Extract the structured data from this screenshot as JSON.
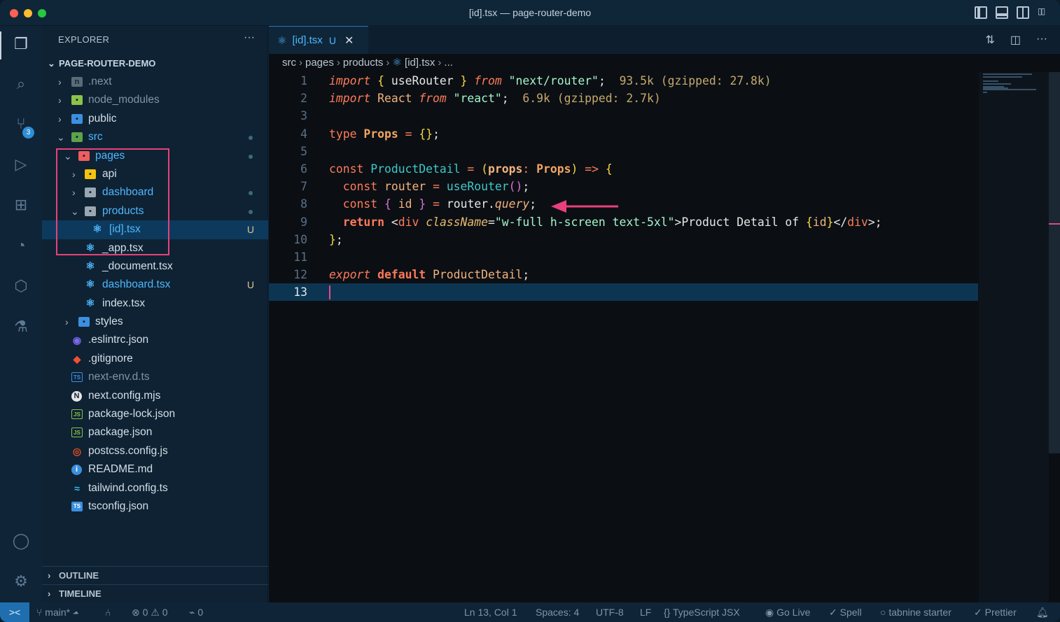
{
  "window": {
    "title": "[id].tsx — page-router-demo"
  },
  "activity": {
    "scm_badge": "3",
    "icons": [
      "explorer-icon",
      "search-icon",
      "source-control-icon",
      "run-debug-icon",
      "extensions-icon",
      "git-graph-icon",
      "remote-icon",
      "testing-icon",
      "account-icon",
      "settings-icon"
    ]
  },
  "sidebar": {
    "header": "EXPLORER",
    "more": "···",
    "project": "PAGE-ROUTER-DEMO",
    "outline": "OUTLINE",
    "timeline": "TIMELINE",
    "items": [
      {
        "label": ".next",
        "kind": "folder",
        "expanded": false
      },
      {
        "label": "node_modules",
        "kind": "folder",
        "expanded": false
      },
      {
        "label": "public",
        "kind": "folder",
        "expanded": false
      },
      {
        "label": "src",
        "kind": "folder",
        "expanded": true
      },
      {
        "label": "pages",
        "kind": "folder",
        "expanded": true
      },
      {
        "label": "api",
        "kind": "folder",
        "expanded": false
      },
      {
        "label": "dashboard",
        "kind": "folder",
        "expanded": false
      },
      {
        "label": "products",
        "kind": "folder",
        "expanded": true
      },
      {
        "label": "[id].tsx",
        "kind": "file",
        "status": "U"
      },
      {
        "label": "_app.tsx",
        "kind": "file"
      },
      {
        "label": "_document.tsx",
        "kind": "file"
      },
      {
        "label": "dashboard.tsx",
        "kind": "file",
        "status": "U"
      },
      {
        "label": "index.tsx",
        "kind": "file"
      },
      {
        "label": "styles",
        "kind": "folder",
        "expanded": false
      },
      {
        "label": ".eslintrc.json",
        "kind": "file"
      },
      {
        "label": ".gitignore",
        "kind": "file"
      },
      {
        "label": "next-env.d.ts",
        "kind": "file"
      },
      {
        "label": "next.config.mjs",
        "kind": "file"
      },
      {
        "label": "package-lock.json",
        "kind": "file"
      },
      {
        "label": "package.json",
        "kind": "file"
      },
      {
        "label": "postcss.config.js",
        "kind": "file"
      },
      {
        "label": "README.md",
        "kind": "file"
      },
      {
        "label": "tailwind.config.ts",
        "kind": "file"
      },
      {
        "label": "tsconfig.json",
        "kind": "file"
      }
    ]
  },
  "editor": {
    "tab": {
      "label": "[id].tsx",
      "status": "U",
      "close": "✕"
    },
    "breadcrumb": [
      "src",
      "pages",
      "products",
      "[id].tsx",
      "..."
    ],
    "line_numbers": [
      "1",
      "2",
      "3",
      "4",
      "5",
      "6",
      "7",
      "8",
      "9",
      "10",
      "11",
      "12",
      "13"
    ],
    "code": {
      "l1": {
        "kw": "import",
        "b1": "{",
        "id": "useRouter",
        "b2": "}",
        "from": "from",
        "str": "\"next/router\"",
        "semi": ";",
        "size": "93.5k (gzipped: 27.8k)"
      },
      "l2": {
        "kw": "import",
        "id": "React",
        "from": "from",
        "str": "\"react\"",
        "semi": ";",
        "size": "6.9k (gzipped: 2.7k)"
      },
      "l4": {
        "kw": "type",
        "name": "Props",
        "eq": "=",
        "obj": "{}",
        "semi": ";"
      },
      "l6": {
        "kw": "const",
        "name": "ProductDetail",
        "eq": "=",
        "po": "(",
        "param": "props",
        "colon": ":",
        "type": "Props",
        "pc": ")",
        "arrow": "=>",
        "brace": "{"
      },
      "l7": {
        "kw": "const",
        "name": "router",
        "eq": "=",
        "fn": "useRouter",
        "call": "()",
        "semi": ";"
      },
      "l8": {
        "kw": "const",
        "b1": "{",
        "id": "id",
        "b2": "}",
        "eq": "=",
        "obj": "router.",
        "prop": "query",
        "semi": ";"
      },
      "l9": {
        "kw": "return",
        "lt": "<",
        "tag": "div",
        "attr": "className",
        "eq": "=",
        "str": "\"w-full h-screen text-5xl\"",
        "gt": ">",
        "text": "Product Detail of ",
        "b1": "{",
        "id": "id",
        "b2": "}",
        "close_lt": "</",
        "close_tag": "div",
        "close_gt": ">",
        "semi": ";"
      },
      "l10": {
        "brace": "}",
        "semi": ";"
      },
      "l12": {
        "kw1": "export",
        "kw2": "default",
        "name": "ProductDetail",
        "semi": ";"
      }
    }
  },
  "status": {
    "remote": "><",
    "branch": "main*",
    "errors": "0",
    "warnings": "0",
    "ports": "0",
    "position": "Ln 13, Col 1",
    "spaces": "Spaces: 4",
    "encoding": "UTF-8",
    "eol": "LF",
    "language": "TypeScript JSX",
    "golive": "Go Live",
    "spell": "Spell",
    "tabnine": "tabnine starter",
    "prettier": "Prettier"
  },
  "colors": {
    "accent": "#1f6fb0",
    "annotation": "#e8417a",
    "selection": "#0d3a5c"
  }
}
